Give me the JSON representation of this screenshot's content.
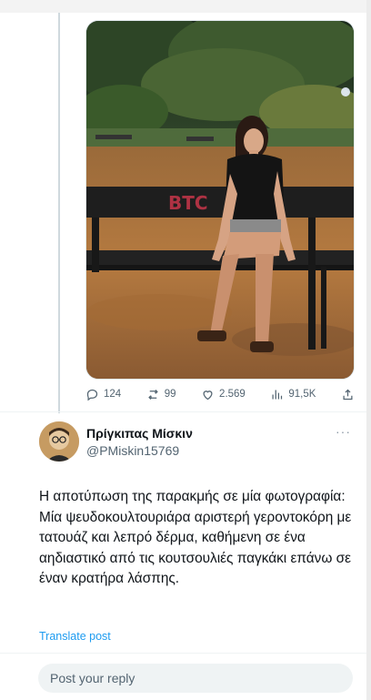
{
  "tweet_image": {
    "alt": "Woman sitting on a park bench at night",
    "graffiti_text": "BTC"
  },
  "stats": {
    "replies": "124",
    "reposts": "99",
    "likes": "2.569",
    "views": "91,5K"
  },
  "reply_tweet": {
    "display_name": "Πρίγκιπας Μίσκιν",
    "handle": "@PMiskin15769",
    "more": "···",
    "text": "Η αποτύπωση της παρακμής σε μία φωτογραφία: Μία ψευδοκουλτουριάρα αριστερή γεροντοκόρη με τατουάζ και λεπρό δέρμα, καθήμενη σε ένα αηδιαστικό από τις κουτσουλιές παγκάκι επάνω σε έναν κρατήρα λάσπης.",
    "translate_label": "Translate post"
  },
  "reply_box": {
    "placeholder": "Post your reply"
  },
  "colors": {
    "accent": "#1d9bf0",
    "muted": "#536471",
    "text": "#0f1419"
  },
  "icons": [
    "reply-icon",
    "repost-icon",
    "like-icon",
    "views-icon",
    "share-icon"
  ]
}
